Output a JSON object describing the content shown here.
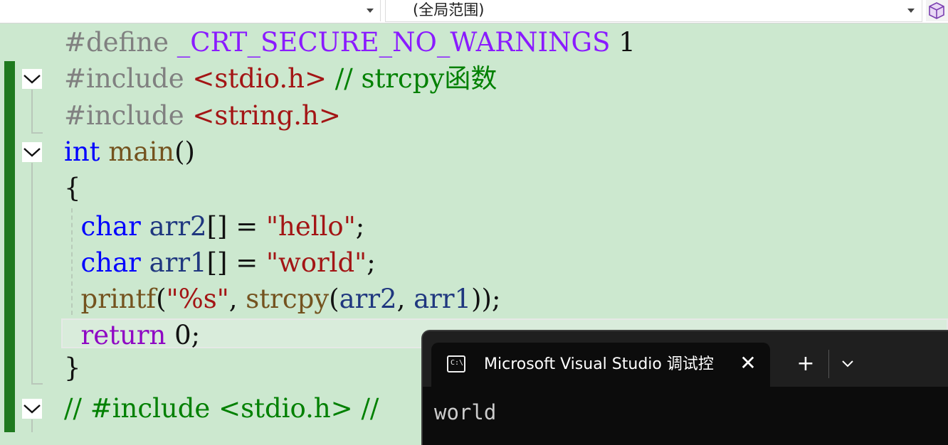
{
  "nav_bar": {
    "left_combo_value": "",
    "scope_combo_value": "(全局范围)"
  },
  "code": {
    "line1": {
      "directive": "#define",
      "macro": "_CRT_SECURE_NO_WARNINGS",
      "value": "1"
    },
    "line2": {
      "directive": "#include",
      "header": "<stdio.h>",
      "comment": "// strcpy函数"
    },
    "line3": {
      "directive": "#include",
      "header": "<string.h>"
    },
    "line4": {
      "type": "int",
      "func": "main",
      "parens": "()"
    },
    "line5": {
      "brace": "{"
    },
    "line6": {
      "type": "char",
      "var": "arr2",
      "rest": "[] = ",
      "string": "\"hello\"",
      "end": ";"
    },
    "line7": {
      "type": "char",
      "var": "arr1",
      "rest": "[] = ",
      "string": "\"world\"",
      "end": ";"
    },
    "line8": {
      "func": "printf",
      "open": "(",
      "fmt": "\"%s\"",
      "mid": ", ",
      "func2": "strcpy",
      "open2": "(",
      "arg1": "arr2",
      "comma": ", ",
      "arg2": "arr1",
      "close": "));"
    },
    "line9": {
      "keyword": "return",
      "value": "0",
      "end": ";"
    },
    "line10": {
      "brace": "}"
    },
    "line11": {
      "comment1": "// #include <stdio.h> //"
    }
  },
  "console": {
    "title": "Microsoft Visual Studio 调试控",
    "icon": "C:\\",
    "close_glyph": "✕",
    "new_tab_glyph": "+",
    "output_line1": "world"
  },
  "colors": {
    "editor_background": "#cce8cf",
    "change_bar": "#1f7a1f",
    "keyword": "#0000ff",
    "string": "#a31515",
    "comment": "#008000",
    "console_background": "#0c0c0c"
  }
}
